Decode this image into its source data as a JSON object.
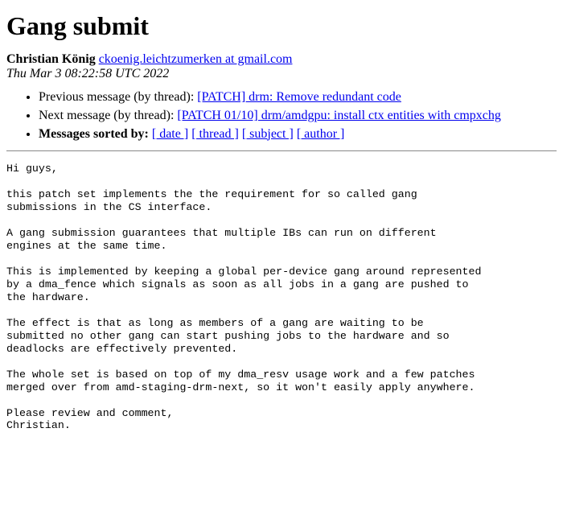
{
  "title": "Gang submit",
  "author": {
    "name": "Christian König",
    "email_text": "ckoenig.leichtzumerken at gmail.com"
  },
  "date": "Thu Mar 3 08:22:58 UTC 2022",
  "nav": {
    "prev_label": "Previous message (by thread): ",
    "prev_link": "[PATCH] drm: Remove redundant code",
    "next_label": "Next message (by thread): ",
    "next_link": "[PATCH 01/10] drm/amdgpu: install ctx entities with cmpxchg",
    "sort_label": "Messages sorted by:",
    "sort_links": {
      "date": "[ date ]",
      "thread": "[ thread ]",
      "subject": "[ subject ]",
      "author": "[ author ]"
    }
  },
  "body": "Hi guys,\n\nthis patch set implements the the requirement for so called gang\nsubmissions in the CS interface.\n\nA gang submission guarantees that multiple IBs can run on different\nengines at the same time.\n\nThis is implemented by keeping a global per-device gang around represented\nby a dma_fence which signals as soon as all jobs in a gang are pushed to\nthe hardware.\n\nThe effect is that as long as members of a gang are waiting to be\nsubmitted no other gang can start pushing jobs to the hardware and so\ndeadlocks are effectively prevented.\n\nThe whole set is based on top of my dma_resv usage work and a few patches\nmerged over from amd-staging-drm-next, so it won't easily apply anywhere.\n\nPlease review and comment,\nChristian."
}
